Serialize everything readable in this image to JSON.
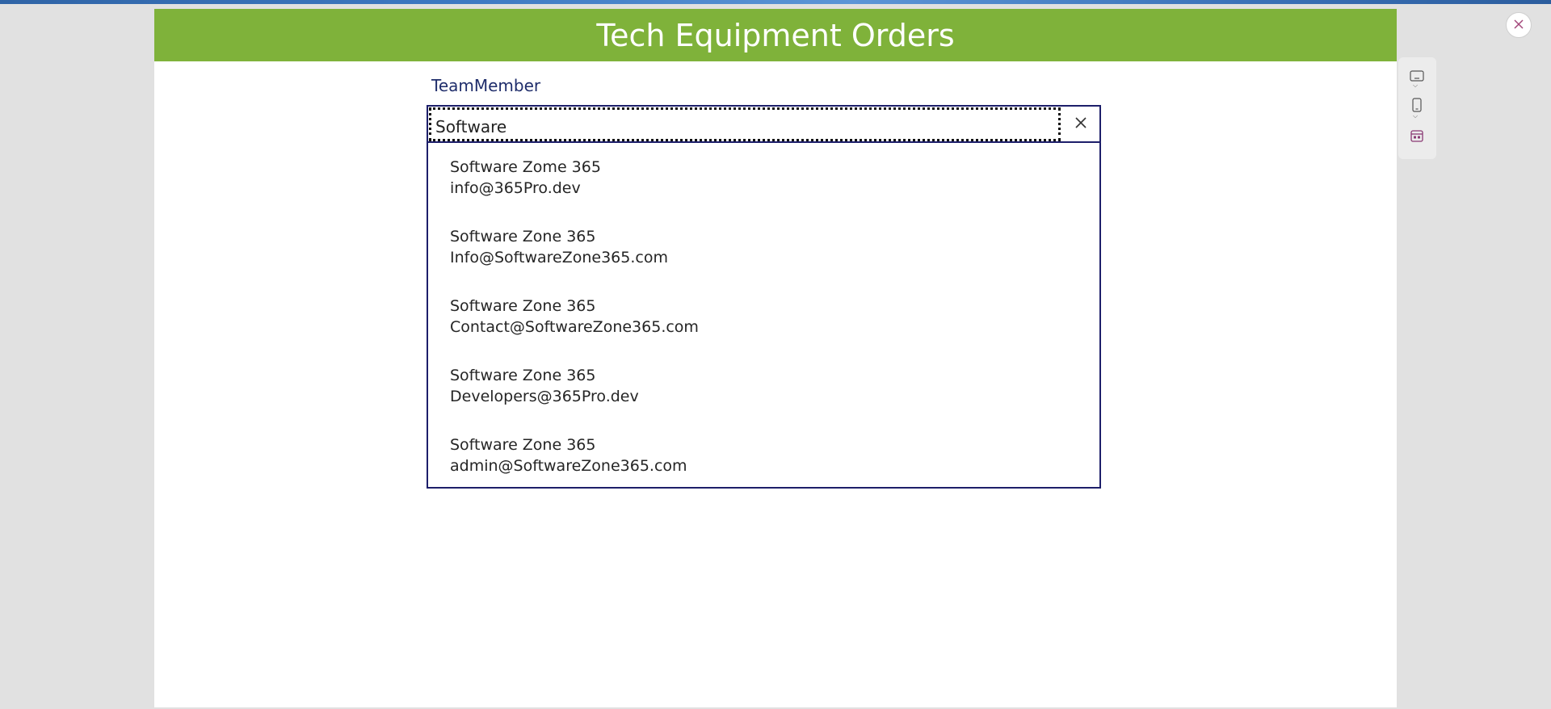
{
  "header": {
    "title": "Tech Equipment Orders"
  },
  "form": {
    "field_label": "TeamMember",
    "search": {
      "value": "Software"
    },
    "results": [
      {
        "name": "Software Zome 365",
        "email": "info@365Pro.dev"
      },
      {
        "name": "Software Zone 365",
        "email": "Info@SoftwareZone365.com"
      },
      {
        "name": "Software Zone 365",
        "email": "Contact@SoftwareZone365.com"
      },
      {
        "name": "Software Zone 365",
        "email": "Developers@365Pro.dev"
      },
      {
        "name": "Software Zone 365",
        "email": "admin@SoftwareZone365.com"
      }
    ]
  },
  "icons": {
    "clear": "close-icon",
    "panel": [
      "tablet-landscape-icon",
      "phone-icon",
      "calendar-icon"
    ],
    "window_close": "close-icon"
  },
  "colors": {
    "header_bg": "#7fb23a",
    "border": "#1d1f6a",
    "label": "#1f2d6b",
    "close_accent": "#a3467a"
  }
}
